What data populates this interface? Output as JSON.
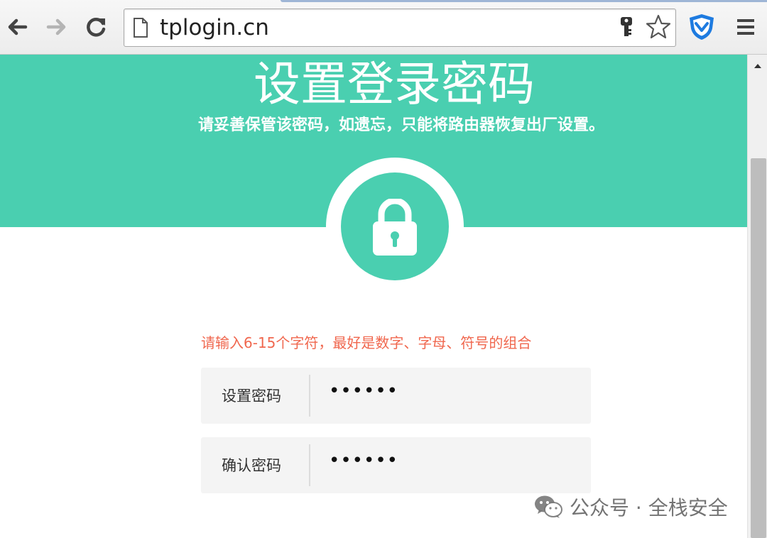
{
  "browser": {
    "url": "tplogin.cn",
    "icons": {
      "back": "back-arrow-icon",
      "forward": "forward-arrow-icon",
      "reload": "reload-icon",
      "page": "page-icon",
      "key": "key-icon",
      "star": "bookmark-star-icon",
      "shield": "shield-extension-icon",
      "menu": "hamburger-menu-icon"
    }
  },
  "page": {
    "title": "设置登录密码",
    "subtitle": "请妥善保管该密码，如遗忘，只能将路由器恢复出厂设置。",
    "hint": "请输入6-15个字符，最好是数字、字母、符号的组合",
    "fields": [
      {
        "label": "设置密码",
        "value": "••••••"
      },
      {
        "label": "确认密码",
        "value": "••••••"
      }
    ],
    "colors": {
      "accent": "#4acfb0",
      "hint": "#f0674e"
    }
  },
  "watermark": {
    "text": "公众号 · 全栈安全",
    "icon": "wechat-icon"
  }
}
